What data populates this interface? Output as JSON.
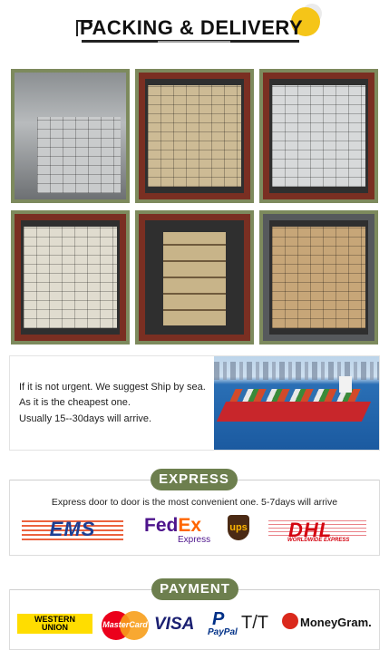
{
  "header": {
    "title": "PACKING & DELIVERY"
  },
  "photos": [
    {
      "icon": "warehouse-packed-boxes-photo"
    },
    {
      "icon": "container-loaded-cartons-photo"
    },
    {
      "icon": "container-wrapped-cartons-photo"
    },
    {
      "icon": "container-stacked-cartons-photo"
    },
    {
      "icon": "container-plywood-pallets-photo"
    },
    {
      "icon": "container-mixed-cartons-photo"
    }
  ],
  "sea": {
    "line1": "If it is not urgent. We suggest Ship by sea.",
    "line2": "As it is the cheapest one.",
    "line3": "Usually 15--30days will arrive.",
    "image_icon": "container-ship-photo"
  },
  "express": {
    "label": "EXPRESS",
    "description": "Express door to door is the most convenient one. 5-7days will arrive",
    "carriers": {
      "ems": "EMS",
      "fedex_fe": "Fed",
      "fedex_ex": "Ex",
      "fedex_sub": "Express",
      "ups": "ups",
      "dhl": "DHL",
      "dhl_sub": "WORLDWIDE EXPRESS"
    }
  },
  "payment": {
    "label": "PAYMENT",
    "methods": {
      "western_union": "WESTERN UNION",
      "mastercard": "MasterCard",
      "visa": "VISA",
      "paypal_mark": "P",
      "paypal": "PayPal",
      "tt": "T/T",
      "moneygram": "MoneyGram."
    }
  },
  "colors": {
    "accent_green": "#6d7f4e",
    "photo_border": "#7d8a5d",
    "header_circle": "#f5c518"
  }
}
